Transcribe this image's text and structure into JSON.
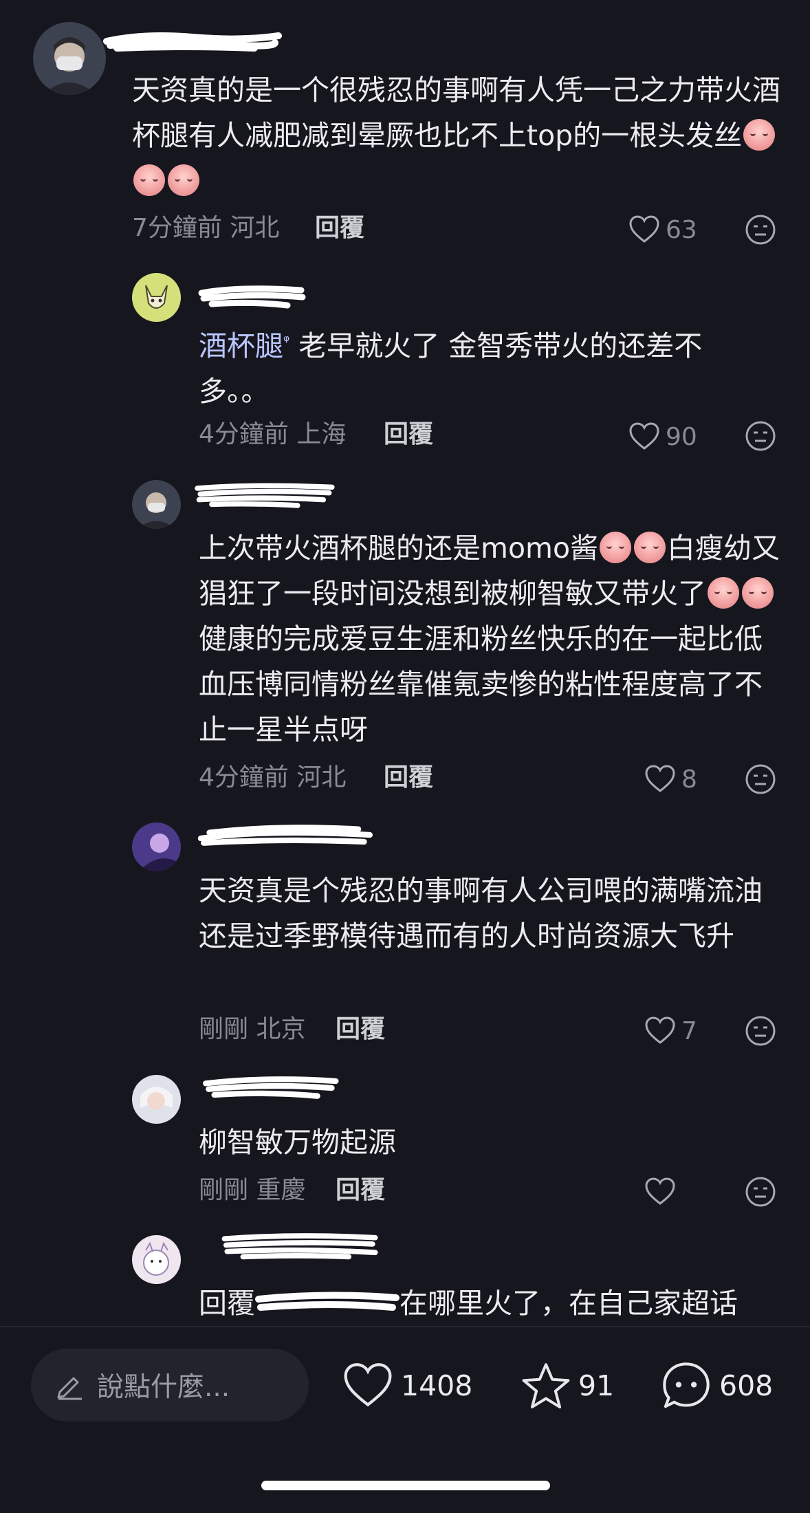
{
  "comments": [
    {
      "text": "天资真的是一个很残忍的事啊有人凭一己之力带火酒杯腿有人减肥减到晕厥也比不上top的一根头发丝",
      "emoji_count": 3,
      "time": "7分鐘前",
      "location": "河北",
      "reply_label": "回覆",
      "likes": "63"
    },
    {
      "mention": "酒杯腿",
      "mention_icon": "search-icon",
      "text": " 老早就火了 金智秀带火的还差不多。。",
      "time": "4分鐘前",
      "location": "上海",
      "reply_label": "回覆",
      "likes": "90"
    },
    {
      "text_a": "上次带火酒杯腿的还是momo酱",
      "text_b": "白瘦幼又猖狂了一段时间没想到被柳智敏又带火了",
      "text_c": "健康的完成爱豆生涯和粉丝快乐的在一起比低血压博同情粉丝靠催氪卖惨的粘性程度高了不止一星半点呀",
      "time": "4分鐘前",
      "location": "河北",
      "reply_label": "回覆",
      "likes": "8"
    },
    {
      "text": "天资真是个残忍的事啊有人公司喂的满嘴流油还是过季野模待遇而有的人时尚资源大飞升",
      "time": "剛剛",
      "location": "北京",
      "reply_label": "回覆",
      "likes": "7"
    },
    {
      "text": "柳智敏万物起源",
      "time": "剛剛",
      "location": "重慶",
      "reply_label": "回覆",
      "likes": ""
    },
    {
      "prefix": "回覆",
      "text": "在哪里火了，在自己家超话"
    }
  ],
  "bottom_bar": {
    "input_placeholder": "說點什麼...",
    "likes": "1408",
    "favorites": "91",
    "comments": "608"
  },
  "colors": {
    "background": "#16161e",
    "text": "#ececf0",
    "muted": "#8a8a96",
    "mention": "#b9c6ff"
  }
}
